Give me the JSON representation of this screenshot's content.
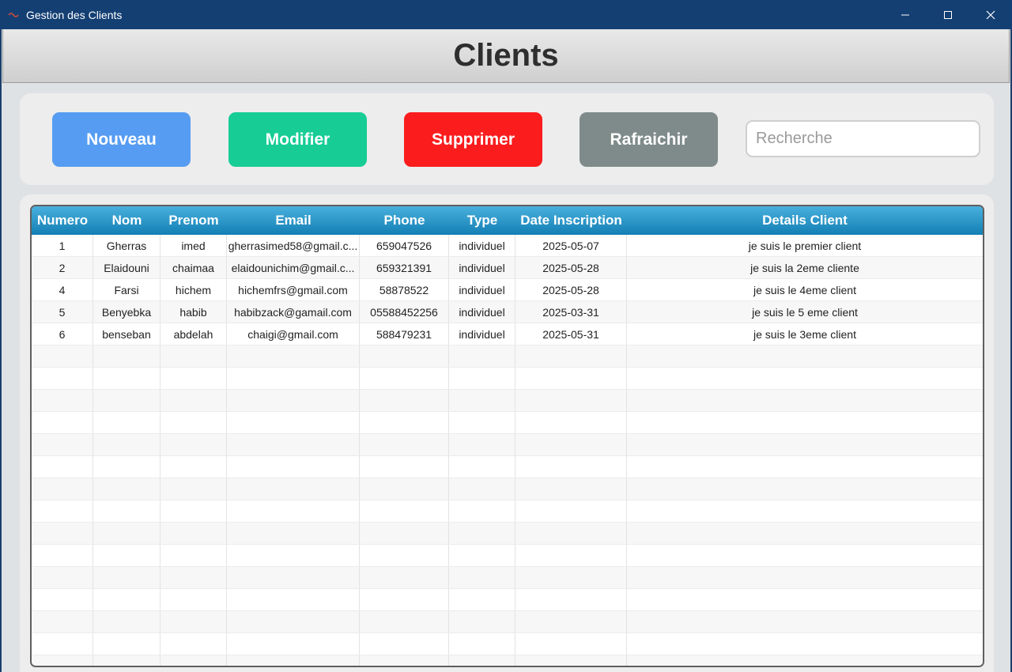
{
  "window": {
    "title": "Gestion des Clients"
  },
  "header": {
    "title": "Clients"
  },
  "toolbar": {
    "new_label": "Nouveau",
    "edit_label": "Modifier",
    "delete_label": "Supprimer",
    "refresh_label": "Rafraichir",
    "search_placeholder": "Recherche"
  },
  "colors": {
    "new": "#569cf2",
    "edit": "#17cd95",
    "delete": "#fb1d1e",
    "refresh": "#7f8b8a",
    "titlebar": "#143f73",
    "table_header": "#1e8fc4"
  },
  "table": {
    "columns": [
      "Numero",
      "Nom",
      "Prenom",
      "Email",
      "Phone",
      "Type",
      "Date Inscription",
      "Details Client"
    ],
    "rows": [
      [
        "1",
        "Gherras",
        "imed",
        "gherrasimed58@gmail.c...",
        "659047526",
        "individuel",
        "2025-05-07",
        "je suis le premier client"
      ],
      [
        "2",
        "Elaidouni",
        "chaimaa",
        "elaidounichim@gmail.c...",
        "659321391",
        "individuel",
        "2025-05-28",
        "je suis la 2eme cliente"
      ],
      [
        "4",
        "Farsi",
        "hichem",
        "hichemfrs@gmail.com",
        "58878522",
        "individuel",
        "2025-05-28",
        "je suis le 4eme client"
      ],
      [
        "5",
        "Benyebka",
        "habib",
        "habibzack@gamail.com",
        "05588452256",
        "individuel",
        "2025-03-31",
        "je suis le 5 eme client"
      ],
      [
        "6",
        "benseban",
        "abdelah",
        "chaigi@gmail.com",
        "588479231",
        "individuel",
        "2025-05-31",
        "je suis le 3eme client"
      ]
    ]
  }
}
